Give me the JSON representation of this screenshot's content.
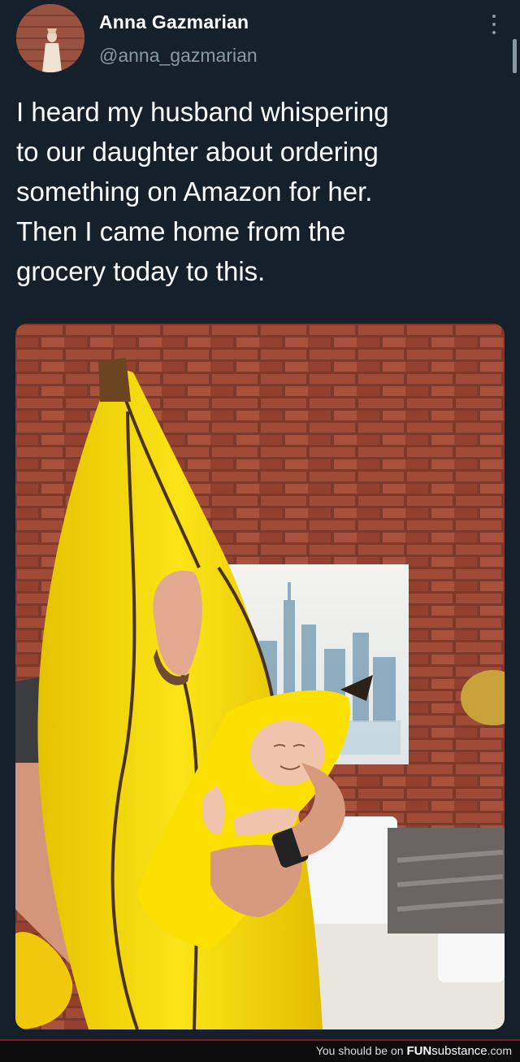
{
  "tweet": {
    "author_name": "Anna Gazmarian",
    "author_handle": "@anna_gazmarian",
    "text": "I heard my husband whispering\nto our daughter about ordering\nsomething on Amazon for her.\nThen I came home from the\ngrocery today to this.",
    "photo_icon": "photo-icon",
    "more_icon": "more-options-icon"
  },
  "footer": {
    "prefix": "You should be on ",
    "brand": "FUN",
    "brand_rest": "substance",
    "suffix": ".com"
  },
  "colors": {
    "background": "#15202b",
    "text_primary": "#ffffff",
    "text_secondary": "#8899a6",
    "banana_yellow": "#f5d90a",
    "brick_red": "#8b3a2e"
  }
}
